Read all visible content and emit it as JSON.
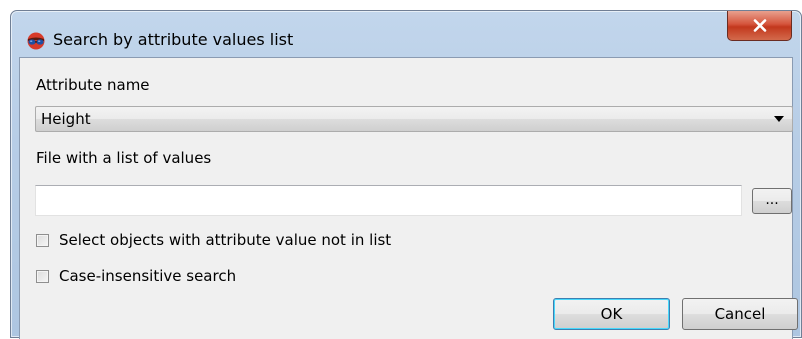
{
  "window": {
    "title": "Search by attribute values list",
    "app_icon": "glasses-icon",
    "close_icon": "close-icon"
  },
  "attribute": {
    "label": "Attribute name",
    "selected_value": "Height"
  },
  "file": {
    "label": "File with a list of values",
    "value": "",
    "browse_label": "..."
  },
  "options": {
    "not_in_list_label": "Select objects with attribute value not in list",
    "not_in_list_checked": false,
    "case_insensitive_label": "Case-insensitive search",
    "case_insensitive_checked": false
  },
  "buttons": {
    "ok_label": "OK",
    "cancel_label": "Cancel"
  },
  "colors": {
    "title_bar": "#b9cfe7",
    "close_button": "#c94a2e",
    "ok_focus_border": "#3c7fb1",
    "client_bg": "#f0f0f0"
  }
}
